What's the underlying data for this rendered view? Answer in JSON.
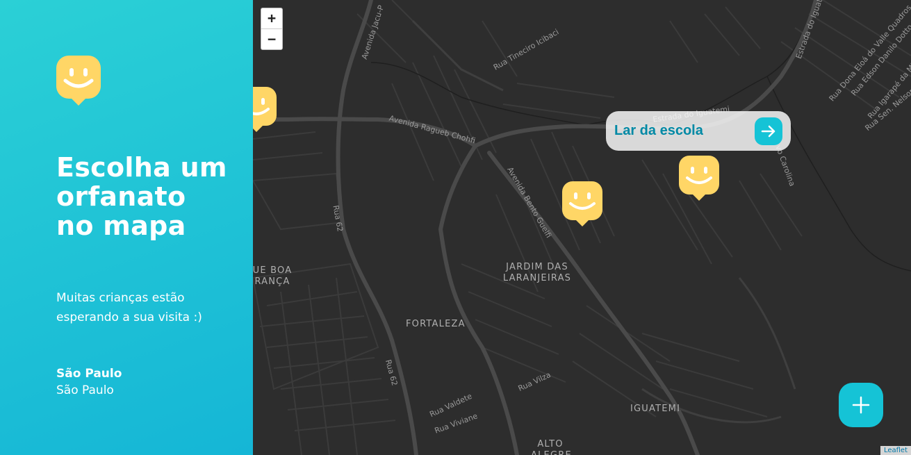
{
  "sidebar": {
    "title": "Escolha um orfanato no mapa",
    "subtitle": "Muitas crianças estão esperando a sua visita :)",
    "city": "São Paulo",
    "state": "São Paulo",
    "logo_icon": "happy-face-marker-icon"
  },
  "map": {
    "zoom_in": "+",
    "zoom_out": "−",
    "streets": [
      "Avenida Jacu-P",
      "Rua Tineciro Icibaci",
      "Estrada do Iguat",
      "Avenida Ragueb Chohfi",
      "Estrada do Iguatemi",
      "Rua 62",
      "Avenida Bento Guelfi",
      "Rua 62",
      "Rua Vilza",
      "Rua Valdete",
      "Rua Viviane",
      "Rua Dona Eloá do Valle Quadros",
      "Rua Edson Danilo Dotto",
      "Rua Igarapé da Missão",
      "Rua Sen. Nelson Ca",
      "vo Carolina"
    ],
    "places": [
      "UE BOA RANÇA",
      "JARDIM DAS LARANJEIRAS",
      "FORTALEZA",
      "IGUATEMI",
      "ALTO ALEGRE"
    ],
    "attribution": "Leaflet"
  },
  "popup": {
    "label": "Lar da escola",
    "button_icon": "arrow-right-icon"
  },
  "fab": {
    "icon": "plus-icon"
  },
  "colors": {
    "accent": "#15c3d6",
    "marker": "#ffd666",
    "popup_text": "#0089a5",
    "map_bg": "#2d2d2d"
  }
}
